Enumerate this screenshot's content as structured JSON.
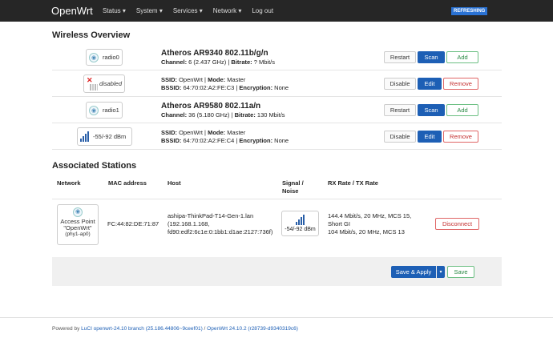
{
  "header": {
    "brand": "OpenWrt",
    "nav": [
      "Status ▾",
      "System ▾",
      "Services ▾",
      "Network ▾",
      "Log out"
    ],
    "badge": "REFRESHING"
  },
  "wireless": {
    "title": "Wireless Overview",
    "radio0": {
      "label": "radio0",
      "model": "Atheros AR9340 802.11b/g/n",
      "channel_label": "Channel:",
      "channel": " 6 (2.437 GHz) | ",
      "bitrate_label": "Bitrate:",
      "bitrate": " ? Mbit/s",
      "buttons": [
        "Restart",
        "Scan",
        "Add"
      ]
    },
    "net0": {
      "status": "disabled",
      "ssid_label": "SSID:",
      "ssid": " OpenWrt | ",
      "mode_label": "Mode:",
      "mode": " Master",
      "bssid_label": "BSSID:",
      "bssid": " 64:70:02:A2:FE:C3 | ",
      "enc_label": "Encryption:",
      "enc": " None",
      "buttons": [
        "Disable",
        "Edit",
        "Remove"
      ]
    },
    "radio1": {
      "label": "radio1",
      "model": "Atheros AR9580 802.11a/n",
      "channel_label": "Channel:",
      "channel": " 36 (5.180 GHz) | ",
      "bitrate_label": "Bitrate:",
      "bitrate": " 130 Mbit/s",
      "buttons": [
        "Restart",
        "Scan",
        "Add"
      ]
    },
    "net1": {
      "signal": "-55/-92 dBm",
      "ssid_label": "SSID:",
      "ssid": " OpenWrt | ",
      "mode_label": "Mode:",
      "mode": " Master",
      "bssid_label": "BSSID:",
      "bssid": " 64:70:02:A2:FE:C4 | ",
      "enc_label": "Encryption:",
      "enc": " None",
      "buttons": [
        "Disable",
        "Edit",
        "Remove"
      ]
    }
  },
  "stations": {
    "title": "Associated Stations",
    "columns": [
      "Network",
      "MAC address",
      "Host",
      "Signal /",
      "Noise",
      "RX Rate / TX Rate"
    ],
    "row": {
      "network_line1": "Access Point",
      "network_line2": "\"OpenWrt\"",
      "network_line3": "(phy1-ap0)",
      "mac": "FC:44:82:DE:71:87",
      "host1": "ashipa-ThinkPad-T14-Gen-1.lan",
      "host2": "(192.168.1.168,",
      "host3": "fd90:edf2:6c1e:0:1bb1:d1ae:2127:736f)",
      "signal": "-54/-92 dBm",
      "rate1": "144.4 Mbit/s, 20 MHz, MCS 15,",
      "rate2": "Short GI",
      "rate3": "104 Mbit/s, 20 MHz, MCS 13",
      "action": "Disconnect"
    }
  },
  "actions": {
    "save_apply": "Save & Apply",
    "dropdown": "▾",
    "save": "Save"
  },
  "footer": {
    "prefix": "Powered by ",
    "luci": "LuCI openwrt-24.10 branch (25.186.44806~9ceef01)",
    "sep": " / ",
    "openwrt": "OpenWrt 24.10.2 (r28739-d9340319c6)"
  }
}
